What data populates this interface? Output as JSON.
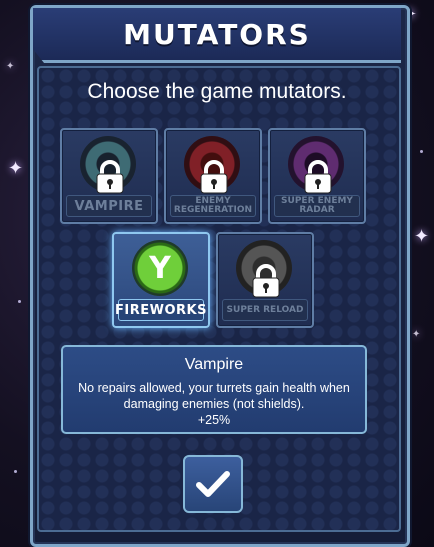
{
  "header": {
    "title": "MUTATORS"
  },
  "subtitle": "Choose the game mutators.",
  "mutators": [
    {
      "label": "VAMPIRE",
      "icon": "vampire-icon",
      "locked": true,
      "selected": false,
      "color": "#3a8a9a"
    },
    {
      "label": "ENEMY REGENERATION",
      "icon": "enemy-regeneration-icon",
      "locked": true,
      "selected": false,
      "color": "#c81d2a"
    },
    {
      "label": "SUPER ENEMY RADAR",
      "icon": "super-enemy-radar-icon",
      "locked": true,
      "selected": false,
      "color": "#8a2fa8"
    },
    {
      "label": "FIREWORKS",
      "icon": "fireworks-icon",
      "locked": false,
      "selected": true,
      "color": "#6fcf3a"
    },
    {
      "label": "SUPER RELOAD",
      "icon": "super-reload-icon",
      "locked": true,
      "selected": false,
      "color": "#6a6a6a"
    }
  ],
  "description": {
    "title": "Vampire",
    "text": "No repairs allowed, your turrets gain health when damaging enemies (not shields).",
    "bonus": "+25%"
  },
  "confirm": {
    "icon": "checkmark-icon"
  }
}
